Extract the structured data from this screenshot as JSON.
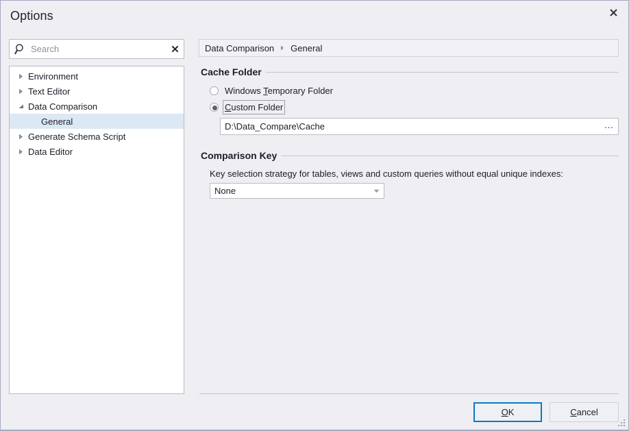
{
  "window": {
    "title": "Options",
    "close_icon": "close-icon"
  },
  "search": {
    "placeholder": "Search",
    "value": "",
    "icon": "search-icon",
    "clear_icon": "clear-icon"
  },
  "tree": {
    "items": [
      {
        "label": "Environment",
        "level": 0,
        "state": "collapsed",
        "selected": false
      },
      {
        "label": "Text Editor",
        "level": 0,
        "state": "collapsed",
        "selected": false
      },
      {
        "label": "Data Comparison",
        "level": 0,
        "state": "expanded",
        "selected": false
      },
      {
        "label": "General",
        "level": 1,
        "state": "leaf",
        "selected": true
      },
      {
        "label": "Generate Schema Script",
        "level": 0,
        "state": "collapsed",
        "selected": false
      },
      {
        "label": "Data Editor",
        "level": 0,
        "state": "collapsed",
        "selected": false
      }
    ]
  },
  "breadcrumb": {
    "parent": "Data Comparison",
    "separator_icon": "chevron-right-icon",
    "current": "General"
  },
  "cache_folder": {
    "group_title": "Cache Folder",
    "options": [
      {
        "label_before": "Windows ",
        "accel": "T",
        "label_after": "emporary Folder",
        "selected": false,
        "focused": false
      },
      {
        "label_before": "",
        "accel": "C",
        "label_after": "ustom Folder",
        "selected": true,
        "focused": true
      }
    ],
    "path_value": "D:\\Data_Compare\\Cache",
    "browse_label": "…",
    "browse_icon": "ellipsis-icon"
  },
  "comparison_key": {
    "group_title": "Comparison Key",
    "description": "Key selection strategy for tables, views and custom queries without equal unique indexes:",
    "selected_value": "None",
    "dropdown_icon": "chevron-down-icon"
  },
  "footer": {
    "ok": {
      "accel": "O",
      "rest": "K"
    },
    "cancel": {
      "accel": "C",
      "rest": "ancel"
    },
    "resize_grip_icon": "resize-grip-icon"
  },
  "colors": {
    "dialog_bg": "#eeeef3",
    "field_bg": "#ffffff",
    "border": "#b9bcc8",
    "selection": "#dde8f5",
    "focus_accent": "#0a79c4",
    "text": "#1c1e26"
  }
}
